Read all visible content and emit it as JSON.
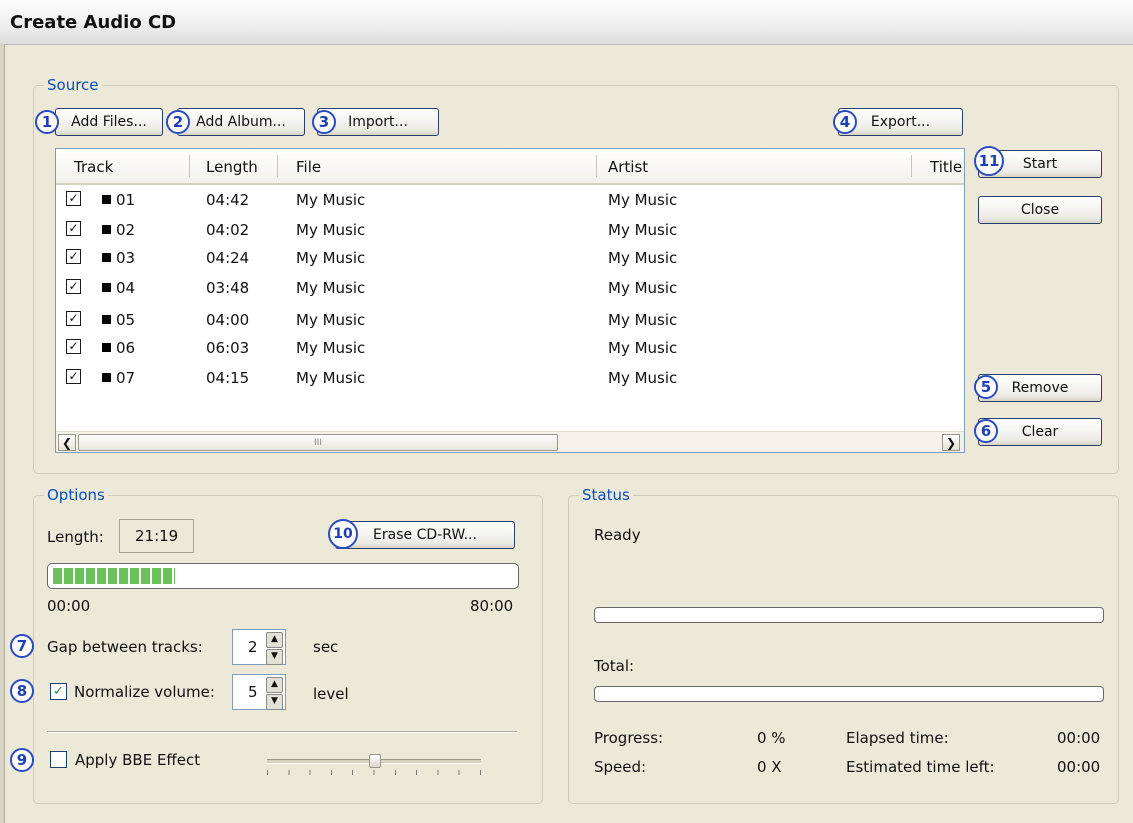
{
  "window": {
    "title": "Create Audio CD"
  },
  "source": {
    "legend": "Source",
    "buttons": {
      "add_files": "Add Files...",
      "add_album": "Add Album...",
      "import": "Import...",
      "export": "Export..."
    },
    "columns": [
      "Track",
      "Length",
      "File",
      "Artist",
      "Title"
    ],
    "tracks": [
      {
        "checked": true,
        "track": "01",
        "length": "04:42",
        "file": "My Music",
        "artist": "My Music"
      },
      {
        "checked": true,
        "track": "02",
        "length": "04:02",
        "file": "My Music",
        "artist": "My Music"
      },
      {
        "checked": true,
        "track": "03",
        "length": "04:24",
        "file": "My Music",
        "artist": "My Music"
      },
      {
        "checked": true,
        "track": "04",
        "length": "03:48",
        "file": "My Music",
        "artist": "My Music"
      },
      {
        "checked": true,
        "track": "05",
        "length": "04:00",
        "file": "My Music",
        "artist": "My Music"
      },
      {
        "checked": true,
        "track": "06",
        "length": "06:03",
        "file": "My Music",
        "artist": "My Music"
      },
      {
        "checked": true,
        "track": "07",
        "length": "04:15",
        "file": "My Music",
        "artist": "My Music"
      }
    ],
    "scroll_thumb_grip": "III"
  },
  "side_buttons": {
    "start": "Start",
    "close": "Close",
    "remove": "Remove",
    "clear": "Clear"
  },
  "badges": [
    "1",
    "2",
    "3",
    "4",
    "5",
    "6",
    "7",
    "8",
    "9",
    "10",
    "11"
  ],
  "options": {
    "legend": "Options",
    "length_label": "Length:",
    "length_value": "21:19",
    "erase_button": "Erase CD-RW...",
    "disc_usage_fraction": 0.266,
    "scale_start": "00:00",
    "scale_end": "80:00",
    "gap_label": "Gap between tracks:",
    "gap_value": "2",
    "gap_unit": "sec",
    "normalize_label": "Normalize volume:",
    "normalize_checked": true,
    "normalize_value": "5",
    "normalize_unit": "level",
    "bbe_label": "Apply BBE Effect",
    "bbe_checked": false,
    "bbe_slider_fraction": 0.5
  },
  "status": {
    "legend": "Status",
    "state": "Ready",
    "total_label": "Total:",
    "progress_label": "Progress:",
    "progress_value": "0 %",
    "speed_label": "Speed:",
    "speed_value": "0 X",
    "elapsed_label": "Elapsed time:",
    "elapsed_value": "00:00",
    "estimated_label": "Estimated time left:",
    "estimated_value": "00:00"
  },
  "colors": {
    "accent": "#0b4eb8",
    "badge": "#2b4bc1",
    "meter_green": "#4caf3a",
    "background": "#ece9d8"
  }
}
